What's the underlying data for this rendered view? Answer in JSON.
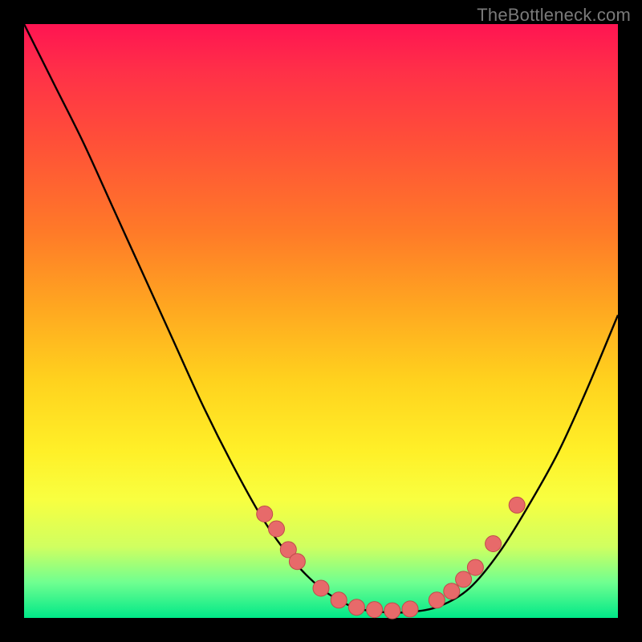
{
  "watermark": "TheBottleneck.com",
  "colors": {
    "page_bg": "#000000",
    "curve_stroke": "#000000",
    "dot_fill": "#e76a6a",
    "dot_stroke": "#c14a4a"
  },
  "chart_data": {
    "type": "line",
    "title": "",
    "xlabel": "",
    "ylabel": "",
    "x": [
      0.0,
      0.05,
      0.1,
      0.15,
      0.2,
      0.25,
      0.3,
      0.35,
      0.4,
      0.45,
      0.5,
      0.55,
      0.6,
      0.65,
      0.7,
      0.75,
      0.8,
      0.85,
      0.9,
      0.95,
      1.0
    ],
    "values": [
      1.0,
      0.9,
      0.8,
      0.69,
      0.58,
      0.47,
      0.36,
      0.26,
      0.17,
      0.1,
      0.05,
      0.02,
      0.01,
      0.01,
      0.02,
      0.05,
      0.11,
      0.19,
      0.28,
      0.39,
      0.51
    ],
    "xlim": [
      0,
      1
    ],
    "ylim": [
      0,
      1
    ],
    "dots": [
      {
        "x": 0.405,
        "y": 0.175
      },
      {
        "x": 0.425,
        "y": 0.15
      },
      {
        "x": 0.445,
        "y": 0.115
      },
      {
        "x": 0.46,
        "y": 0.095
      },
      {
        "x": 0.5,
        "y": 0.05
      },
      {
        "x": 0.53,
        "y": 0.03
      },
      {
        "x": 0.56,
        "y": 0.018
      },
      {
        "x": 0.59,
        "y": 0.014
      },
      {
        "x": 0.62,
        "y": 0.012
      },
      {
        "x": 0.65,
        "y": 0.015
      },
      {
        "x": 0.695,
        "y": 0.03
      },
      {
        "x": 0.72,
        "y": 0.045
      },
      {
        "x": 0.74,
        "y": 0.065
      },
      {
        "x": 0.76,
        "y": 0.085
      },
      {
        "x": 0.79,
        "y": 0.125
      },
      {
        "x": 0.83,
        "y": 0.19
      }
    ]
  }
}
